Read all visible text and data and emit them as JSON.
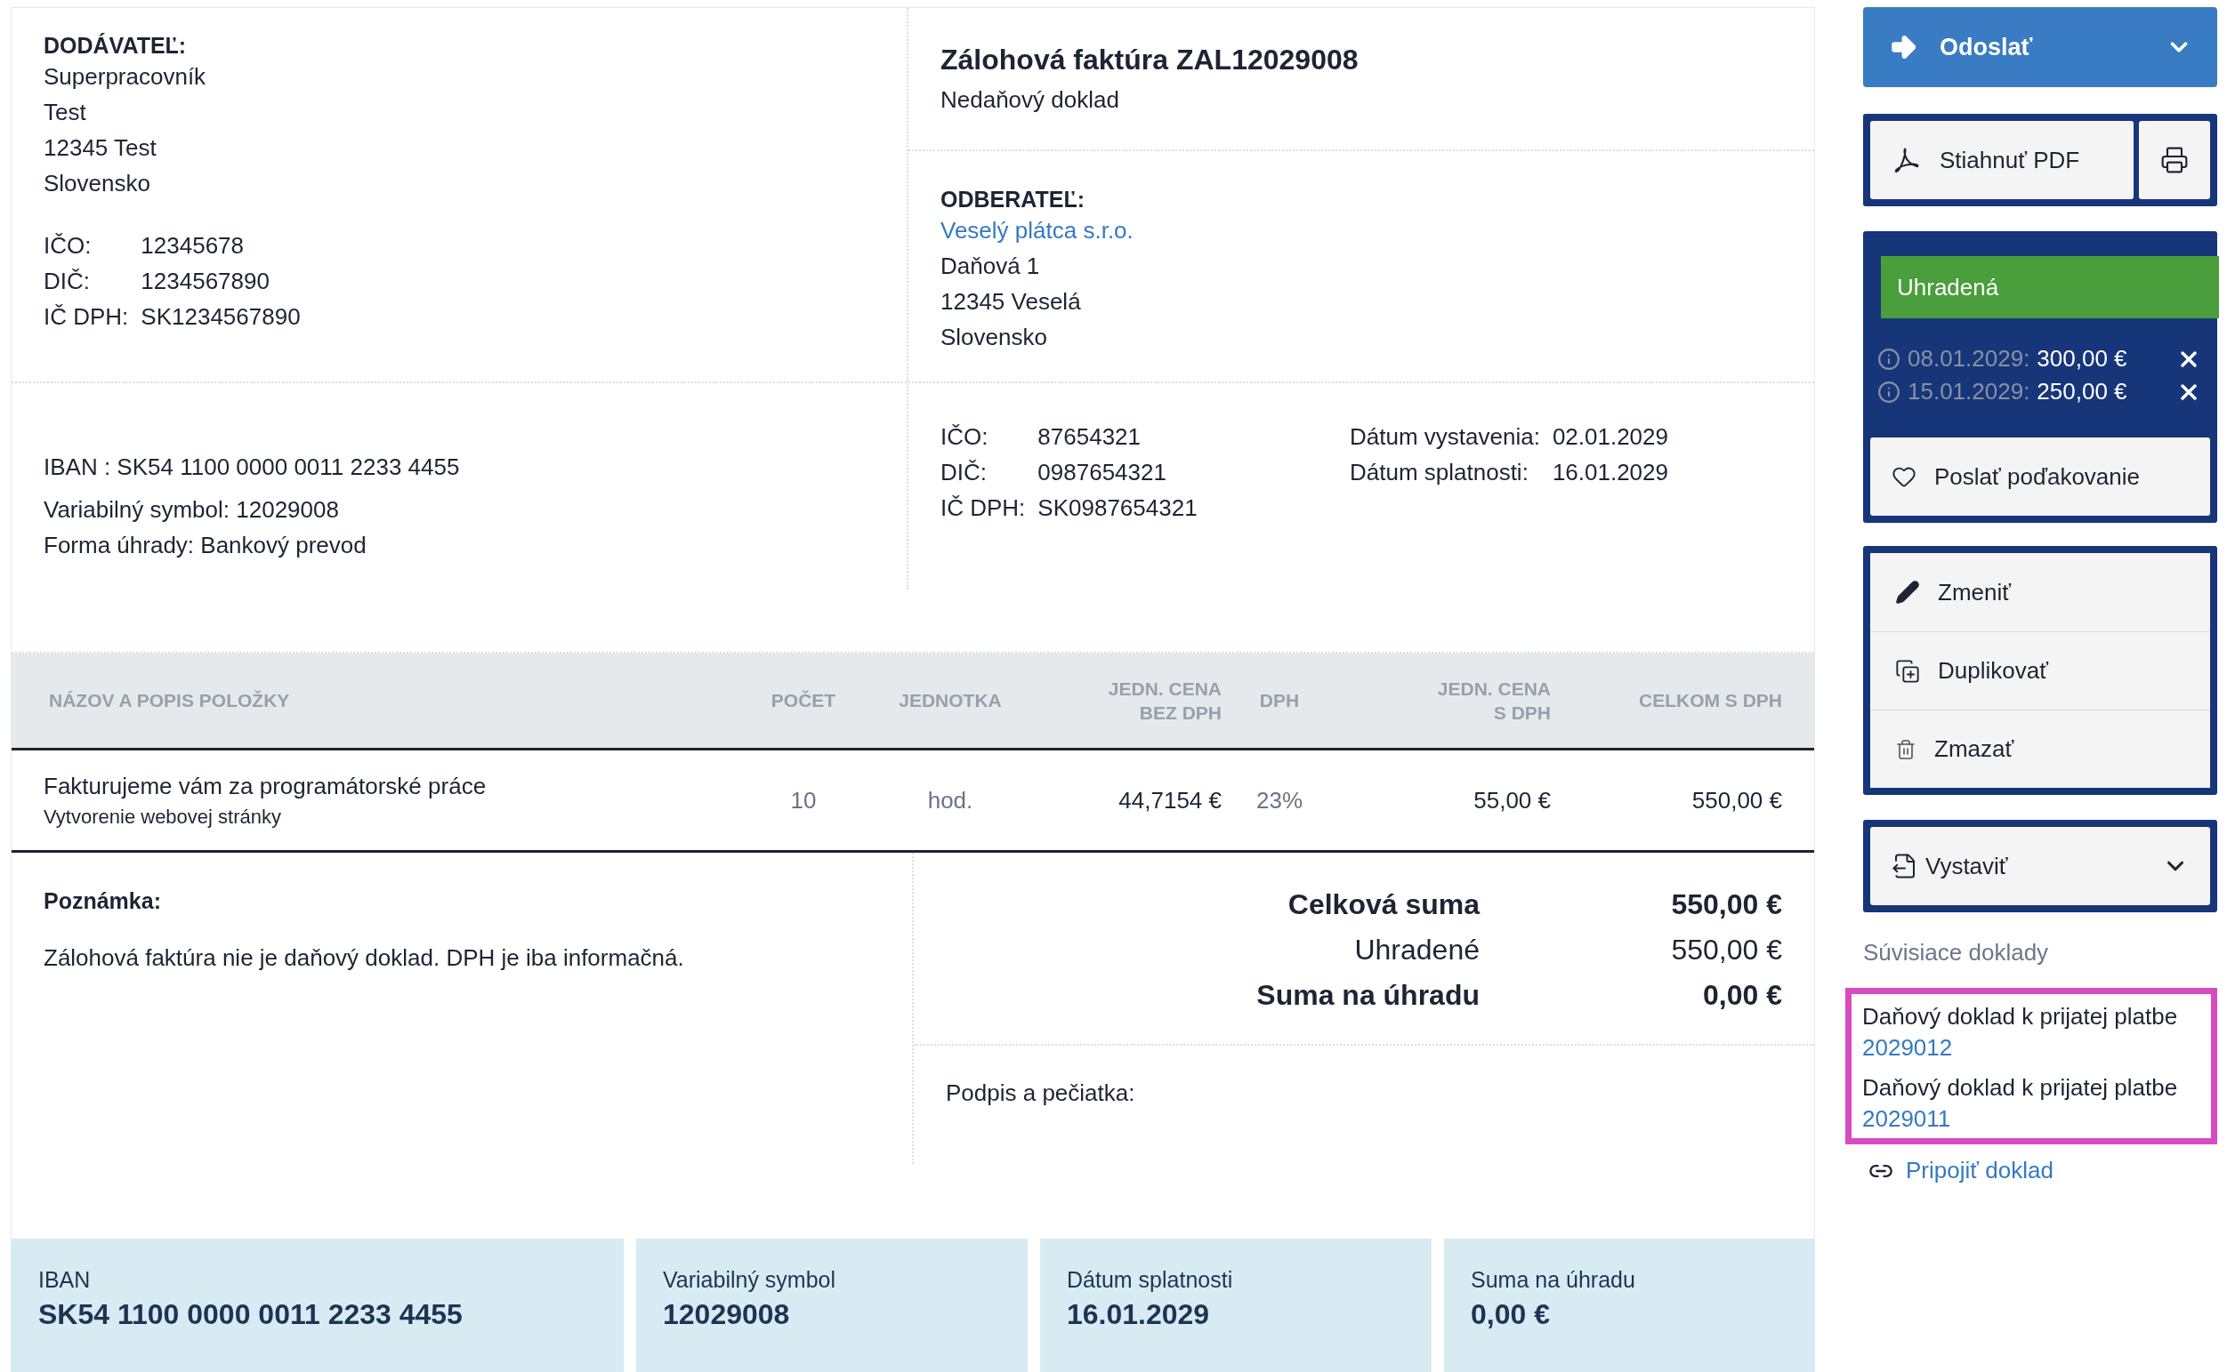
{
  "supplier": {
    "label": "DODÁVATEĽ:",
    "lines": [
      "Superpracovník",
      "Test",
      "12345 Test",
      "Slovensko"
    ],
    "ids": [
      {
        "label": "IČO:",
        "value": "12345678"
      },
      {
        "label": "DIČ:",
        "value": "1234567890"
      },
      {
        "label": "IČ DPH:",
        "value": "SK1234567890"
      }
    ]
  },
  "document": {
    "title": "Zálohová faktúra ZAL12029008",
    "subtitle": "Nedaňový doklad"
  },
  "customer": {
    "label": "ODBERATEĽ:",
    "name": "Veselý plátca s.r.o.",
    "lines": [
      "Daňová 1",
      "12345 Veselá",
      "Slovensko"
    ]
  },
  "payment": [
    "IBAN : SK54 1100 0000 0011 2233 4455",
    "Variabilný symbol: 12029008",
    "Forma úhrady: Bankový prevod"
  ],
  "customer_ids": [
    {
      "label": "IČO:",
      "value": "87654321"
    },
    {
      "label": "DIČ:",
      "value": "0987654321"
    },
    {
      "label": "IČ DPH:",
      "value": "SK0987654321"
    }
  ],
  "dates": [
    {
      "label": "Dátum vystavenia:",
      "value": "02.01.2029"
    },
    {
      "label": "Dátum splatnosti:",
      "value": "16.01.2029"
    }
  ],
  "table": {
    "columns": [
      "NÁZOV A POPIS POLOŽKY",
      "POČET",
      "JEDNOTKA",
      "JEDN. CENA\nBEZ DPH",
      "DPH",
      "JEDN. CENA\nS DPH",
      "CELKOM S DPH"
    ],
    "rows": [
      {
        "item": {
          "name": "Fakturujeme vám za programátorské práce",
          "description": "Vytvorenie webovej stránky"
        },
        "count": "10",
        "unit": "hod.",
        "unit_price": "44,7154 €",
        "vat": "23%",
        "unit_price_vat": "55,00 €",
        "total": "550,00 €"
      }
    ]
  },
  "note": {
    "label": "Poznámka:",
    "text": "Zálohová faktúra nie je daňový doklad. DPH je iba informačná."
  },
  "totals": [
    {
      "label": "Celková suma",
      "value": "550,00 €",
      "bold": true
    },
    {
      "label": "Uhradené",
      "value": "550,00 €",
      "bold": false
    },
    {
      "label": "Suma na úhradu",
      "value": "0,00 €",
      "bold": true
    }
  ],
  "signature": "Podpis a pečiatka:",
  "footer": [
    {
      "label": "IBAN",
      "value": "SK54 1100 0000 0011 2233 4455"
    },
    {
      "label": "Variabilný symbol",
      "value": "12029008"
    },
    {
      "label": "Dátum splatnosti",
      "value": "16.01.2029"
    },
    {
      "label": "Suma na úhradu",
      "value": "0,00 €"
    }
  ],
  "sidebar": {
    "send": "Odoslať",
    "pdf": "Stiahnuť PDF",
    "status": {
      "label": "Uhradená",
      "color": "#4a9e3c"
    },
    "payments": [
      {
        "date": "08.01.2029:",
        "amount": "300,00 €"
      },
      {
        "date": "15.01.2029:",
        "amount": "250,00 €"
      }
    ],
    "thanks": "Poslať poďakovanie",
    "actions": [
      {
        "kind": "edit",
        "label": "Zmeniť"
      },
      {
        "kind": "duplicate",
        "label": "Duplikovať"
      },
      {
        "kind": "delete",
        "label": "Zmazať"
      }
    ],
    "issue": "Vystaviť",
    "related": {
      "title": "Súvisiace doklady",
      "items": [
        {
          "label": "Daňový doklad k prijatej platbe",
          "number": "2029012"
        },
        {
          "label": "Daňový doklad k prijatej platbe",
          "number": "2029011"
        }
      ]
    },
    "attach": "Pripojiť doklad"
  }
}
